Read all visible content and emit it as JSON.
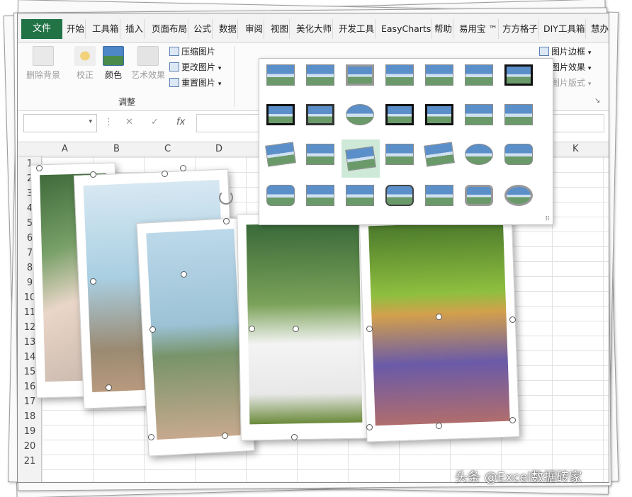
{
  "tabs": [
    "文件",
    "开始",
    "工具箱",
    "插入",
    "页面布局",
    "公式",
    "数据",
    "审阅",
    "视图",
    "美化大师",
    "开发工具",
    "EasyCharts",
    "帮助",
    "易用宝 ™",
    "方方格子",
    "DIY工具箱",
    "慧办"
  ],
  "ribbon": {
    "remove_bg": "删除背景",
    "correct": "校正",
    "color": "颜色",
    "art_effect": "艺术效果",
    "compress": "压缩图片",
    "change": "更改图片",
    "reset": "重置图片",
    "group_adjust": "调整",
    "border": "图片边框",
    "effect": "图片效果",
    "layout": "图片版式"
  },
  "formula": {
    "cancel": "✕",
    "confirm": "✓",
    "fx": "fx"
  },
  "columns": [
    "A",
    "B",
    "C",
    "D",
    "K"
  ],
  "rows": [
    "1",
    "2",
    "3",
    "4",
    "5",
    "6",
    "7",
    "8",
    "9",
    "10",
    "11",
    "12",
    "13",
    "14",
    "15",
    "16",
    "17",
    "18",
    "19",
    "20",
    "21"
  ],
  "watermark": "头条 @Excel数据砖家"
}
